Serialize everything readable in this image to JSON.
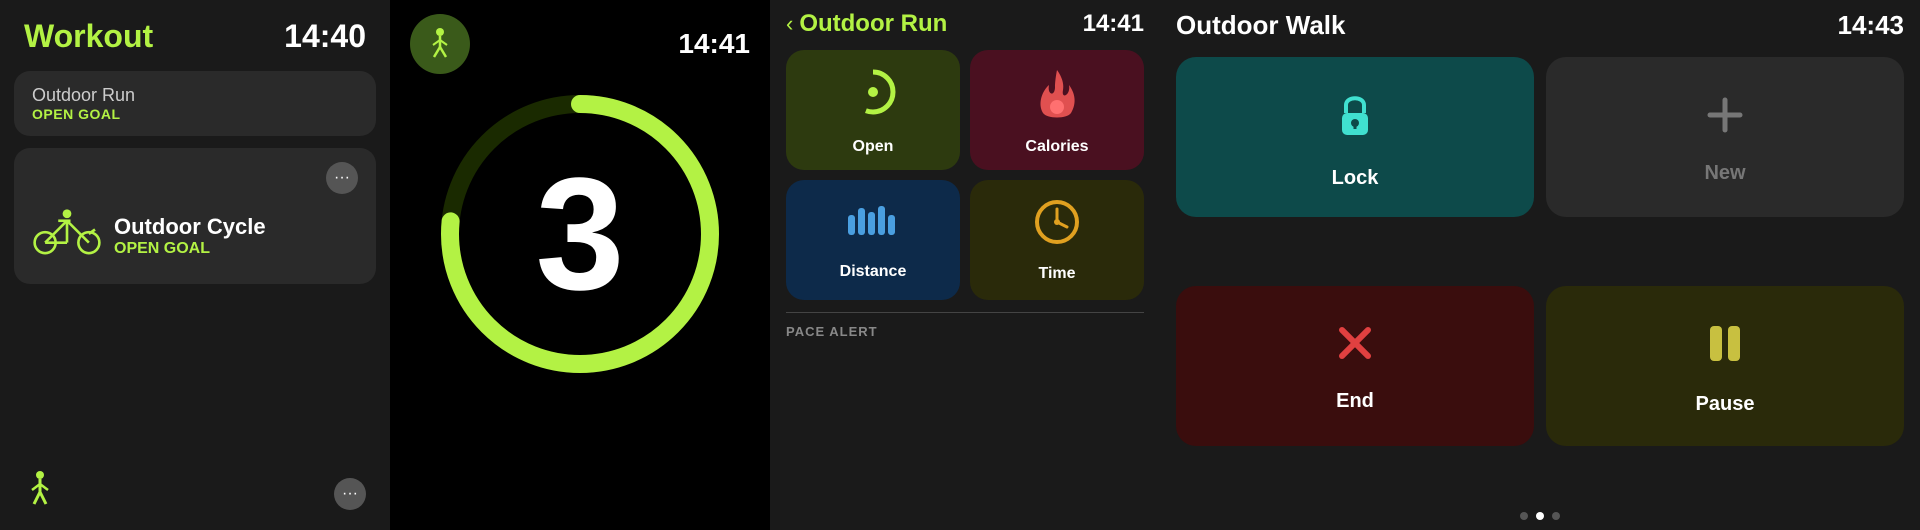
{
  "panel1": {
    "title": "Workout",
    "time": "14:40",
    "items": [
      {
        "name": "Outdoor Run",
        "goal": "OPEN GOAL",
        "icon": "🏃"
      },
      {
        "name": "Outdoor Cycle",
        "goal": "OPEN GOAL",
        "icon": "🚴"
      },
      {
        "name": "Walk",
        "goal": "",
        "icon": "🚶"
      }
    ],
    "dots_label": "···"
  },
  "panel2": {
    "time": "14:41",
    "countdown": "3",
    "icon": "🏃"
  },
  "panel3": {
    "back_label": "‹",
    "title": "Outdoor Run",
    "time": "14:41",
    "metrics": [
      {
        "label": "Open",
        "icon": "open"
      },
      {
        "label": "Calories",
        "icon": "calories"
      },
      {
        "label": "Distance",
        "icon": "distance"
      },
      {
        "label": "Time",
        "icon": "time"
      }
    ],
    "pace_alert": "PACE ALERT"
  },
  "panel4": {
    "title": "Outdoor Walk",
    "time": "14:43",
    "controls": [
      {
        "label": "Lock",
        "icon": "lock",
        "color": "teal"
      },
      {
        "label": "New",
        "icon": "plus",
        "color": "gray"
      },
      {
        "label": "End",
        "icon": "end",
        "color": "red"
      },
      {
        "label": "Pause",
        "icon": "pause",
        "color": "olive"
      }
    ],
    "dots": [
      false,
      true,
      false
    ]
  }
}
